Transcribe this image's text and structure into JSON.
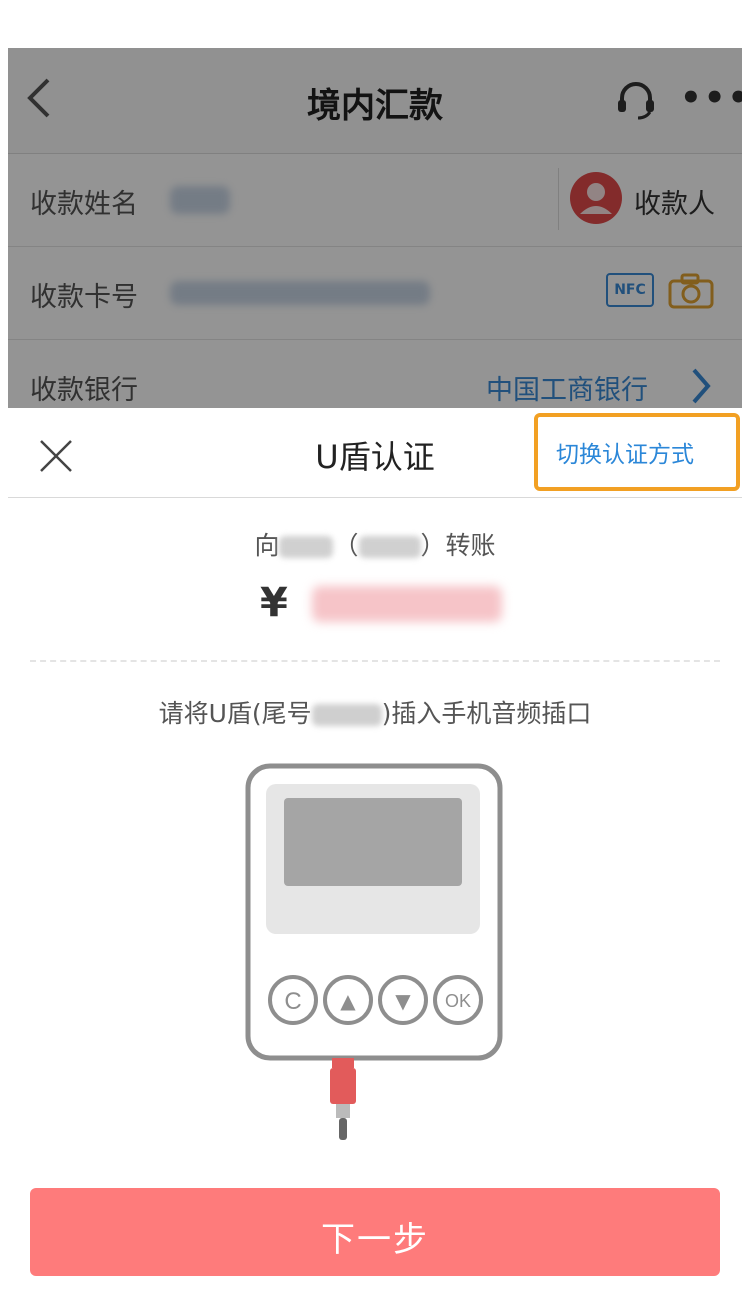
{
  "background": {
    "title": "境内汇款",
    "rows": [
      {
        "label": "收款姓名",
        "action": "收款人"
      },
      {
        "label": "收款卡号",
        "badge": "NFC"
      },
      {
        "label": "收款银行",
        "value": "中国工商银行"
      }
    ]
  },
  "sheet": {
    "title": "U盾认证",
    "switch_label": "切换认证方式",
    "transfer_prefix": "向",
    "transfer_open": "（",
    "transfer_close": "）",
    "transfer_suffix": "转账",
    "currency": "¥",
    "instruction_prefix": "请将U盾(尾号",
    "instruction_suffix": ")插入手机音频插口",
    "device_keys": [
      "C",
      "▲",
      "▼",
      "OK"
    ],
    "next_label": "下一步"
  },
  "colors": {
    "accent_blue": "#2b87d8",
    "highlight_orange": "#f2a023",
    "primary_button": "#fe7b7b",
    "plug_red": "#e25b5b"
  }
}
